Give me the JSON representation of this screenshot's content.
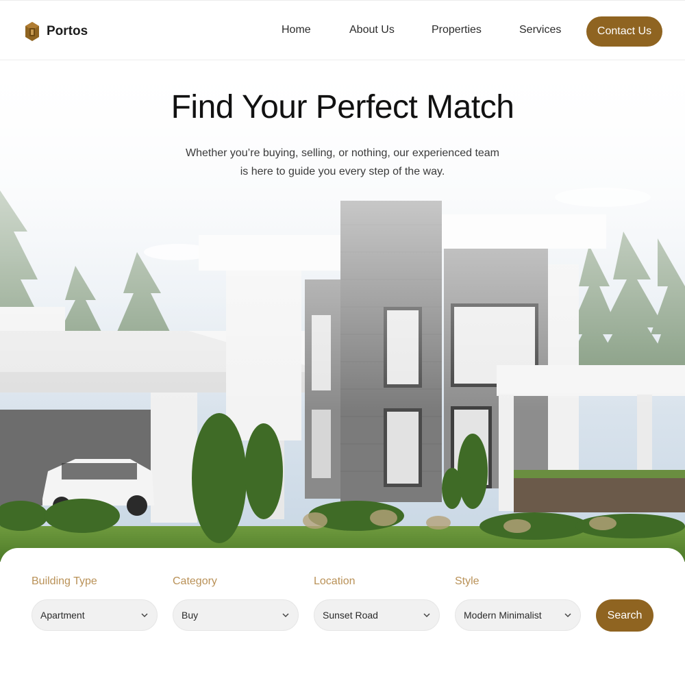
{
  "brand": {
    "name": "Portos"
  },
  "nav": {
    "items": [
      {
        "label": "Home"
      },
      {
        "label": "About Us"
      },
      {
        "label": "Properties"
      },
      {
        "label": "Services"
      }
    ],
    "contact_label": "Contact Us"
  },
  "hero": {
    "title": "Find Your Perfect Match",
    "subtitle": "Whether you’re buying, selling, or nothing, our experienced team is here to guide you every step of the way."
  },
  "search": {
    "fields": [
      {
        "label": "Building Type",
        "value": "Apartment"
      },
      {
        "label": "Category",
        "value": "Buy"
      },
      {
        "label": "Location",
        "value": "Sunset Road"
      },
      {
        "label": "Style",
        "value": "Modern Minimalist"
      }
    ],
    "button_label": "Search"
  },
  "icons": {
    "logo": "hexagon-logo-icon",
    "dropdown": "chevron-down-icon"
  },
  "colors": {
    "accent": "#8f6421",
    "accent_label": "#b99157",
    "text": "#1d1d1d"
  }
}
